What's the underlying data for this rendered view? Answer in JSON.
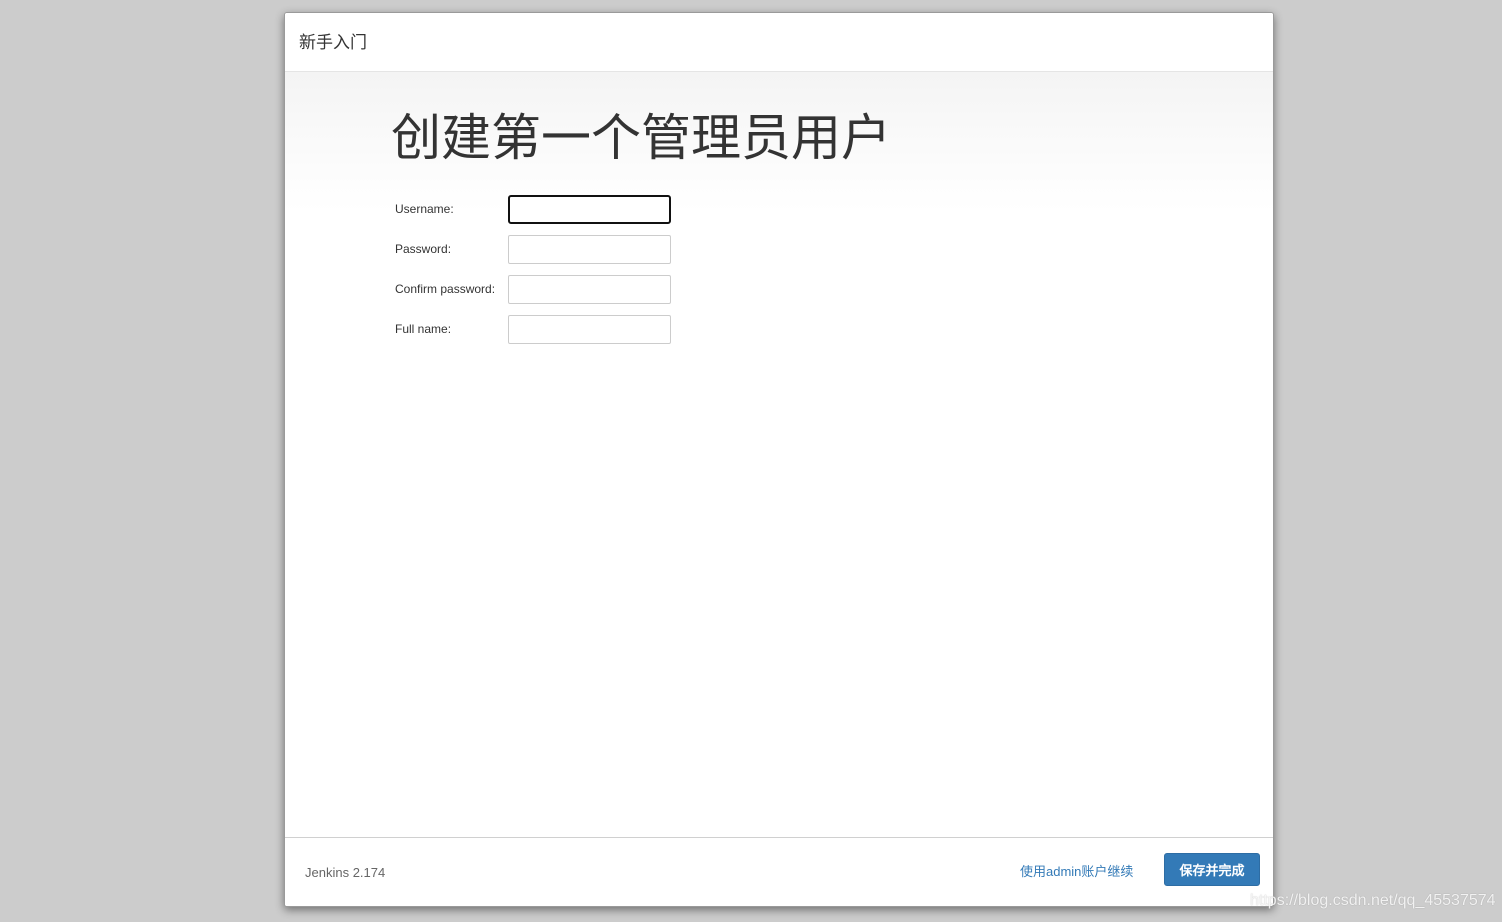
{
  "dialog": {
    "title": "新手入门"
  },
  "main": {
    "heading": "创建第一个管理员用户",
    "form": {
      "username_label": "Username:",
      "username_value": "",
      "password_label": "Password:",
      "password_value": "",
      "confirm_password_label": "Confirm password:",
      "confirm_password_value": "",
      "full_name_label": "Full name:",
      "full_name_value": ""
    }
  },
  "footer": {
    "version": "Jenkins 2.174",
    "continue_link": "使用admin账户继续",
    "save_button": "保存并完成"
  },
  "watermark": "https://blog.csdn.net/qq_45537574",
  "colors": {
    "primary": "#337ab7",
    "page_background": "#cccccc"
  }
}
